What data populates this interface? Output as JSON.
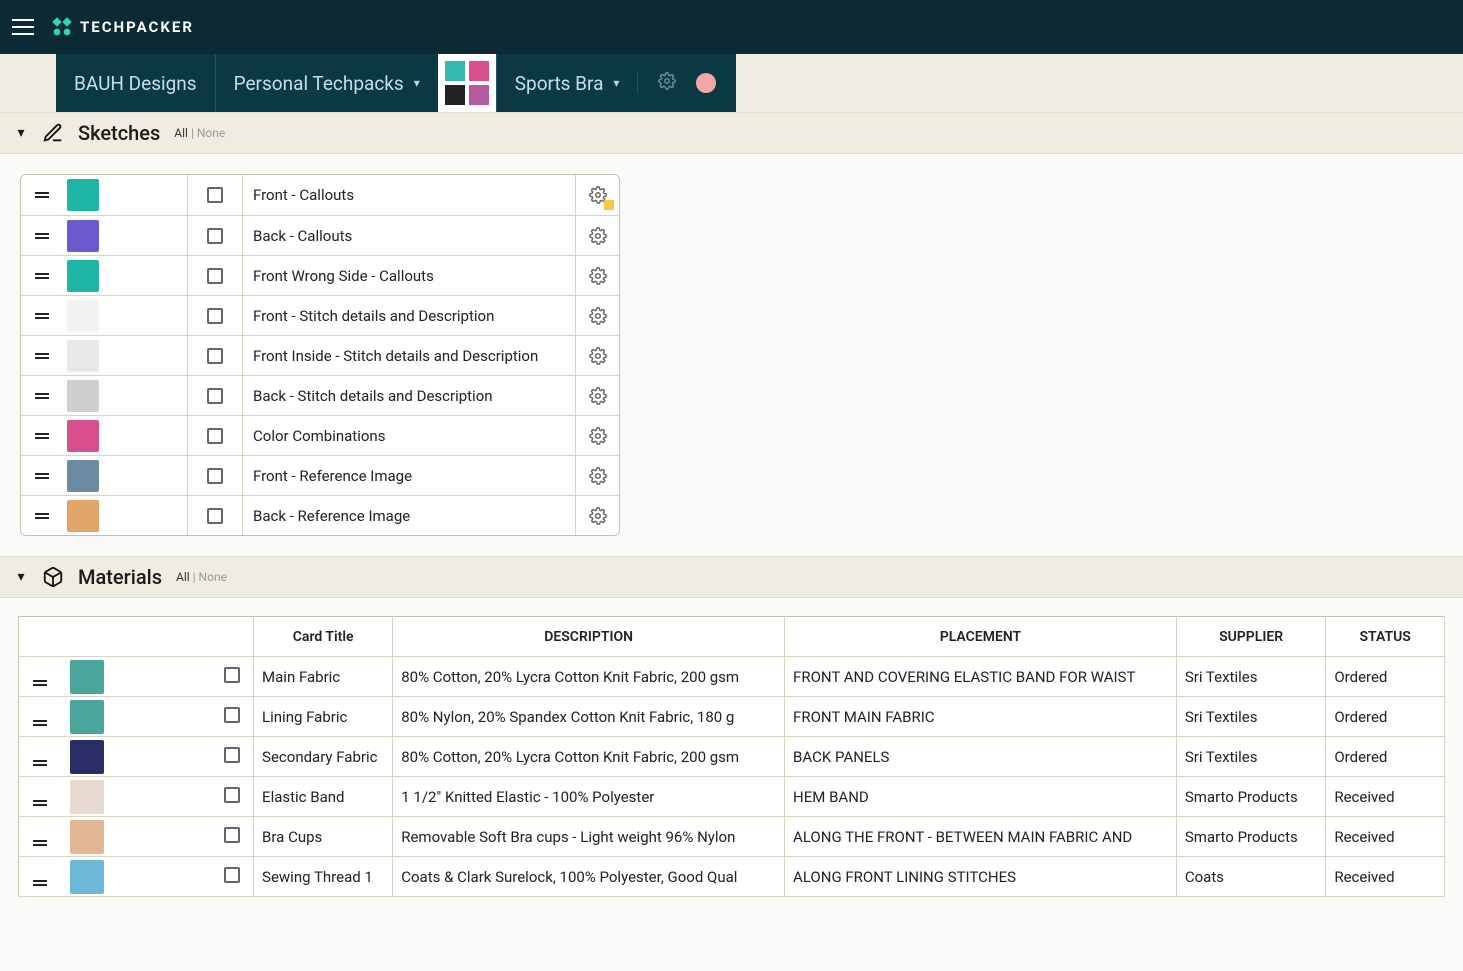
{
  "brand": {
    "name": "TECHPACKER"
  },
  "breadcrumb": {
    "org": "BAUH Designs",
    "collection": "Personal Techpacks",
    "item": "Sports Bra"
  },
  "sections": {
    "sketches": {
      "title": "Sketches",
      "filter_all": "All",
      "filter_none": "None"
    },
    "materials": {
      "title": "Materials",
      "filter_all": "All",
      "filter_none": "None"
    }
  },
  "sketches": [
    {
      "title": "Front - Callouts",
      "thumb_color": "#1fb5a6",
      "highlight": true
    },
    {
      "title": "Back - Callouts",
      "thumb_color": "#6a5acd"
    },
    {
      "title": "Front Wrong Side - Callouts",
      "thumb_color": "#1fb5a6"
    },
    {
      "title": "Front - Stitch details and Description",
      "thumb_color": "#f2f2f2"
    },
    {
      "title": "Front Inside - Stitch details and Description",
      "thumb_color": "#e8e8e8"
    },
    {
      "title": "Back - Stitch details and Description",
      "thumb_color": "#cfcfcf"
    },
    {
      "title": "Color Combinations",
      "thumb_color": "#d94f8e"
    },
    {
      "title": "Front - Reference Image",
      "thumb_color": "#6b8aa3"
    },
    {
      "title": "Back - Reference Image",
      "thumb_color": "#e3a46c"
    }
  ],
  "materials_columns": {
    "card_title": "Card Title",
    "description": "DESCRIPTION",
    "placement": "PLACEMENT",
    "supplier": "SUPPLIER",
    "status": "STATUS"
  },
  "materials": [
    {
      "title": "Main Fabric",
      "description": "80% Cotton, 20% Lycra Cotton Knit Fabric, 200 gsm",
      "placement": "FRONT AND COVERING ELASTIC BAND FOR WAIST",
      "supplier": "Sri Textiles",
      "status": "Ordered",
      "thumb_color": "#4aa69a"
    },
    {
      "title": "Lining Fabric",
      "description": "80% Nylon, 20% Spandex Cotton Knit Fabric, 180 g",
      "placement": "FRONT MAIN FABRIC",
      "supplier": "Sri Textiles",
      "status": "Ordered",
      "thumb_color": "#4aa69a"
    },
    {
      "title": "Secondary Fabric",
      "description": "80% Cotton, 20% Lycra Cotton Knit Fabric, 200 gsm",
      "placement": "BACK PANELS",
      "supplier": "Sri Textiles",
      "status": "Ordered",
      "thumb_color": "#2b2e66"
    },
    {
      "title": "Elastic Band",
      "description": "1 1/2\" Knitted Elastic - 100% Polyester",
      "placement": "HEM BAND",
      "supplier": "Smarto Products",
      "status": "Received",
      "thumb_color": "#e8d9d0"
    },
    {
      "title": "Bra Cups",
      "description": "Removable Soft Bra cups - Light weight 96% Nylon",
      "placement": "ALONG THE FRONT - BETWEEN MAIN FABRIC AND",
      "supplier": "Smarto Products",
      "status": "Received",
      "thumb_color": "#e2b892"
    },
    {
      "title": "Sewing Thread 1",
      "description": "Coats & Clark Surelock, 100% Polyester, Good Qual",
      "placement": "ALONG FRONT LINING STITCHES",
      "supplier": "Coats",
      "status": "Received",
      "thumb_color": "#6bb9d6"
    }
  ]
}
